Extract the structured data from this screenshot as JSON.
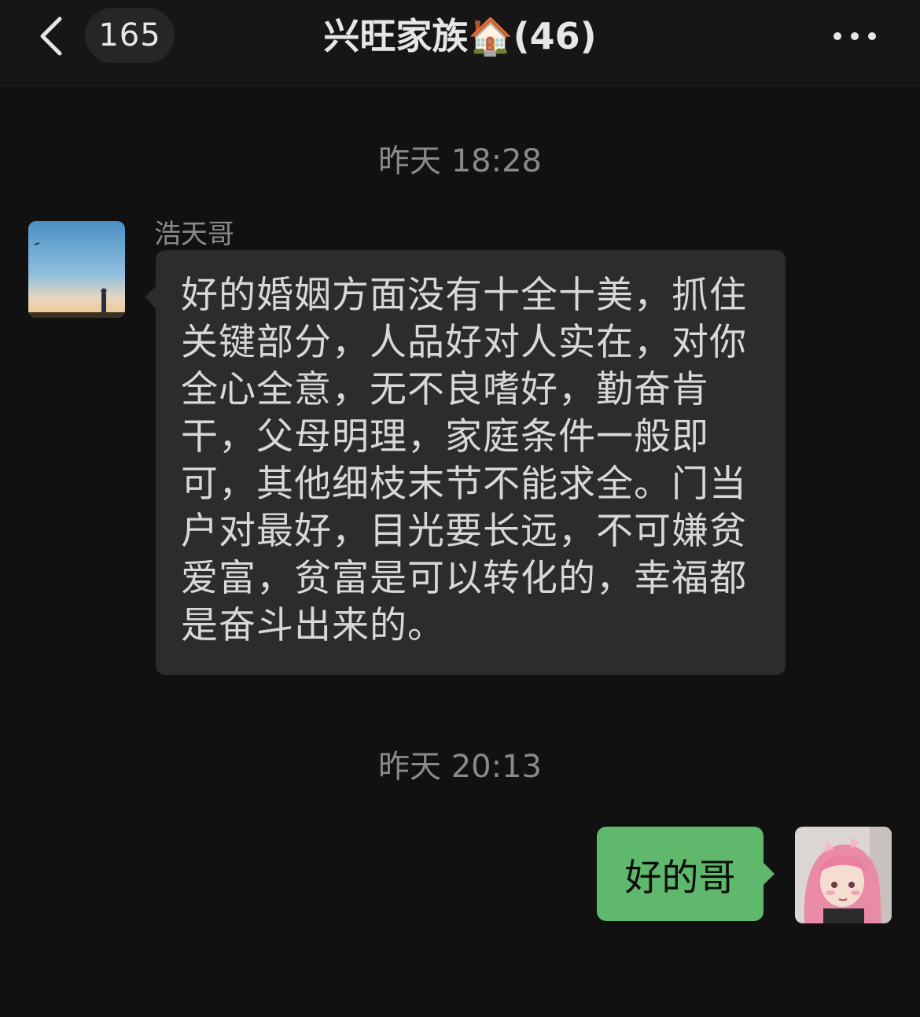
{
  "header": {
    "unread_count": "165",
    "title": "兴旺家族🏠(46)"
  },
  "messages": [
    {
      "timestamp": "昨天 18:28"
    },
    {
      "sender": "浩天哥",
      "text": "好的婚姻方面没有十全十美，抓住关键部分，人品好对人实在，对你全心全意，无不良嗜好，勤奋肯干，父母明理，家庭条件一般即可，其他细枝末节不能求全。门当户对最好，目光要长远，不可嫌贫爱富，贫富是可以转化的，幸福都是奋斗出来的。",
      "side": "left"
    },
    {
      "timestamp": "昨天 20:13"
    },
    {
      "text": "好的哥",
      "side": "right"
    }
  ],
  "colors": {
    "background": "#111111",
    "incoming_bubble": "#2c2c2c",
    "outgoing_bubble": "#5fb86c"
  },
  "icons": {
    "back": "chevron-left-icon",
    "more": "more-dots-icon"
  }
}
